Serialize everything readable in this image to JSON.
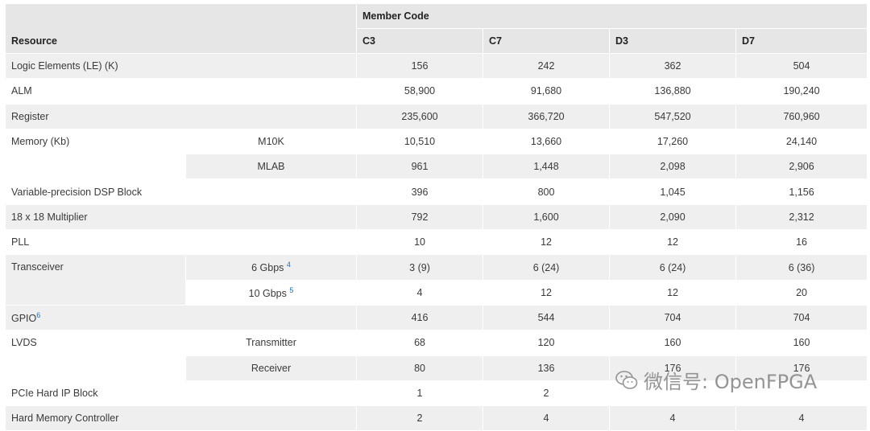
{
  "header": {
    "member_code": "Member Code",
    "resource": "Resource",
    "cols": [
      "C3",
      "C7",
      "D3",
      "D7"
    ]
  },
  "rows": {
    "le": {
      "label": "Logic Elements (LE) (K)",
      "v": [
        "156",
        "242",
        "362",
        "504"
      ]
    },
    "alm": {
      "label": "ALM",
      "v": [
        "58,900",
        "91,680",
        "136,880",
        "190,240"
      ]
    },
    "reg": {
      "label": "Register",
      "v": [
        "235,600",
        "366,720",
        "547,520",
        "760,960"
      ]
    },
    "mem": {
      "label": "Memory (Kb)",
      "m10k": {
        "label": "M10K",
        "v": [
          "10,510",
          "13,660",
          "17,260",
          "24,140"
        ]
      },
      "mlab": {
        "label": "MLAB",
        "v": [
          "961",
          "1,448",
          "2,098",
          "2,906"
        ]
      }
    },
    "dsp": {
      "label": "Variable-precision DSP Block",
      "v": [
        "396",
        "800",
        "1,045",
        "1,156"
      ]
    },
    "mult": {
      "label": "18 x 18 Multiplier",
      "v": [
        "792",
        "1,600",
        "2,090",
        "2,312"
      ]
    },
    "pll": {
      "label": "PLL",
      "v": [
        "10",
        "12",
        "12",
        "16"
      ]
    },
    "trans": {
      "label": "Transceiver",
      "g6": {
        "label": "6 Gbps",
        "sup": "4",
        "v": [
          "3 (9)",
          "6 (24)",
          "6 (24)",
          "6 (36)"
        ]
      },
      "g10": {
        "label": "10 Gbps",
        "sup": "5",
        "v": [
          "4",
          "12",
          "12",
          "20"
        ]
      }
    },
    "gpio": {
      "label": "GPIO",
      "sup": "6",
      "v": [
        "416",
        "544",
        "704",
        "704"
      ]
    },
    "lvds": {
      "label": "LVDS",
      "tx": {
        "label": "Transmitter",
        "v": [
          "68",
          "120",
          "160",
          "160"
        ]
      },
      "rx": {
        "label": "Receiver",
        "v": [
          "80",
          "136",
          "176",
          "176"
        ]
      }
    },
    "pcie": {
      "label": "PCIe Hard IP Block",
      "v": [
        "1",
        "2",
        "",
        ""
      ]
    },
    "hmc": {
      "label": "Hard Memory Controller",
      "v": [
        "2",
        "4",
        "4",
        "4"
      ]
    }
  },
  "watermark": {
    "text": "微信号: OpenFPGA",
    "icon": "wechat-icon",
    "color": "#8a8a8a"
  }
}
